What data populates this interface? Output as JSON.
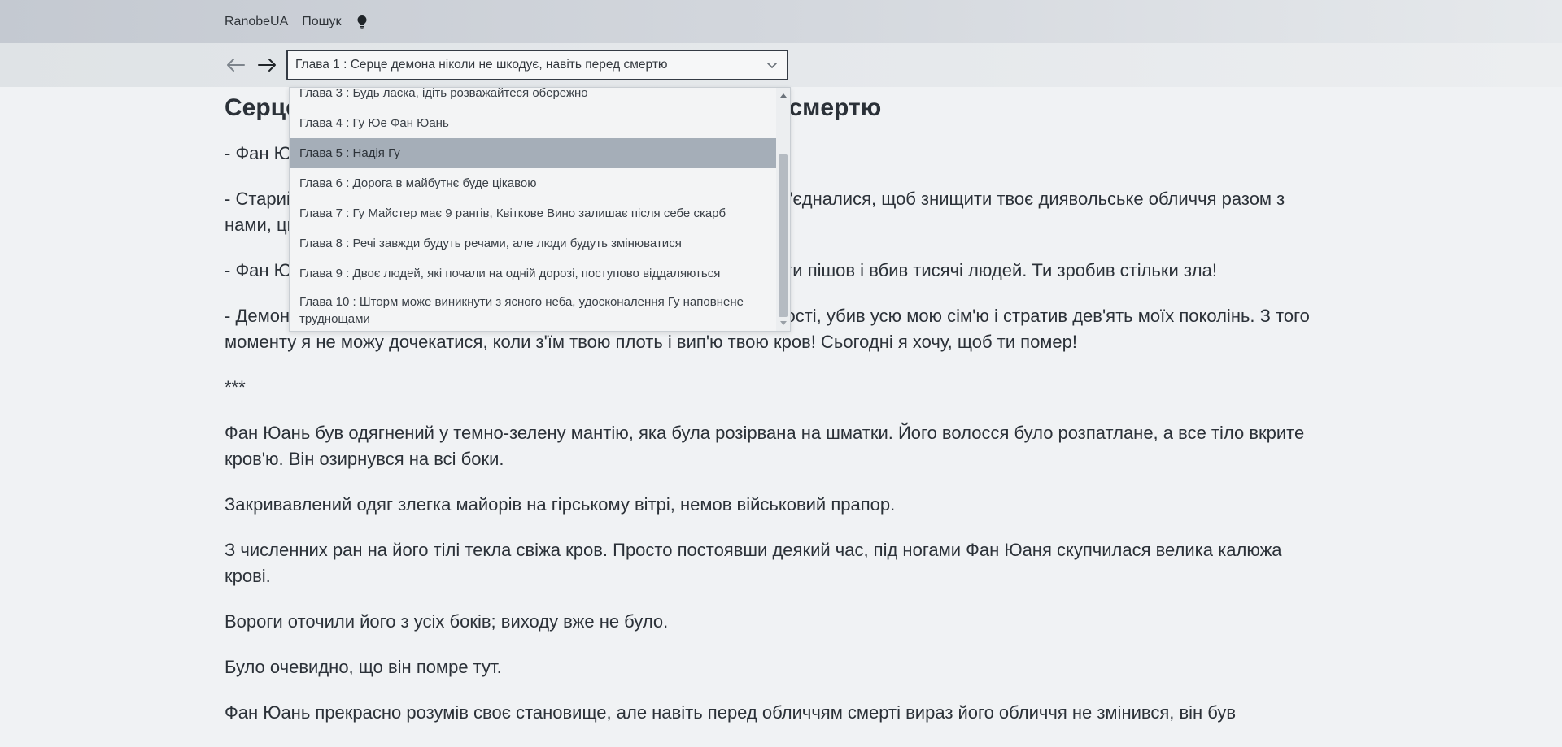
{
  "nav": {
    "brand": "RanobeUA",
    "search": "Пошук",
    "theme_icon": "lightbulb-icon"
  },
  "toolbar": {
    "back_icon": "arrow-left-icon",
    "forward_icon": "arrow-right-icon",
    "selected_chapter": "Глава 1 : Серце демона ніколи не шкодує, навіть перед смертю",
    "dropdown_icon": "chevron-down-icon"
  },
  "dropdown": {
    "items": [
      "Глава 3 : Будь ласка, ідіть розважайтеся обережно",
      "Глава 4 : Гу Юе Фан Юань",
      "Глава 5 : Надія Гу",
      "Глава 6 : Дорога в майбутнє буде цікавою",
      "Глава 7 : Гу Майстер має 9 рангів, Квіткове Вино залишає після себе скарб",
      "Глава 8 : Речі завжди будуть речами, але люди будуть змінюватися",
      "Глава 9 : Двоє людей, які почали на одній дорозі, поступово віддаляються",
      "Глава 10 : Шторм може виникнути з ясного неба, удосконалення Гу наповнене труднощами"
    ],
    "selected_index": 2
  },
  "content": {
    "title": "Серце демона ніколи не шкодує, навіть перед смертю",
    "paragraphs": [
      "- Фан Юань, здавайся, і ми подаруємо тобі швидку смерть!",
      "- Старий Демоне, цього разу всі основні секти праведного шляху об'єдналися, щоб знищити твоє диявольське обличчя разом з нами, цього разу тебе точно обезголовлять!",
      "- Фан Юань, заради того, щоб удосконалити Цикаду Весни і Осені, ти пішов і вбив тисячі людей. Ти зробив стільки зла!",
      "- Демон, триста років тому ти образив мене, позбавив мене невинності, убив усю мою сім'ю і стратив дев'ять моїх поколінь. З того моменту я не можу дочекатися, коли з'їм твою плоть і вип'ю твою кров! Сьогодні я хочу, щоб ти помер!",
      "***",
      "Фан Юань був одягнений у темно-зелену мантію, яка була розірвана на шматки. Його волосся було розпатлане, а все тіло вкрите кров'ю. Він озирнувся на всі боки.",
      "Закривавлений одяг злегка майорів на гірському вітрі, немов військовий прапор.",
      "З численних ран на його тілі текла свіжа кров. Просто постоявши деякий час, під ногами Фан Юаня скупчилася велика калюжа крові.",
      "Вороги оточили його з усіх боків; виходу вже не було.",
      "Було очевидно, що він помре тут.",
      "Фан Юань прекрасно розумів своє становище, але навіть перед обличчям смерті вираз його обличчя не змінився, він був"
    ]
  }
}
